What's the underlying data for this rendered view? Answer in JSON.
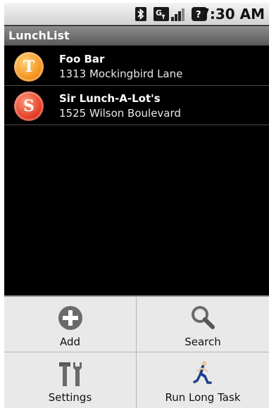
{
  "status_bar": {
    "time": "7:30 AM"
  },
  "title_bar": {
    "title": "LunchList"
  },
  "restaurants": [
    {
      "name": "Foo Bar",
      "address": "1313 Mockingbird Lane",
      "type_icon": "take-out-icon",
      "type_letter": "T",
      "color": "#f08a12"
    },
    {
      "name": "Sir Lunch-A-Lot's",
      "address": "1525 Wilson Boulevard",
      "type_icon": "sit-down-icon",
      "type_letter": "S",
      "color": "#e0301c"
    }
  ],
  "menu": {
    "add": "Add",
    "search": "Search",
    "settings": "Settings",
    "run_long_task": "Run Long Task"
  }
}
